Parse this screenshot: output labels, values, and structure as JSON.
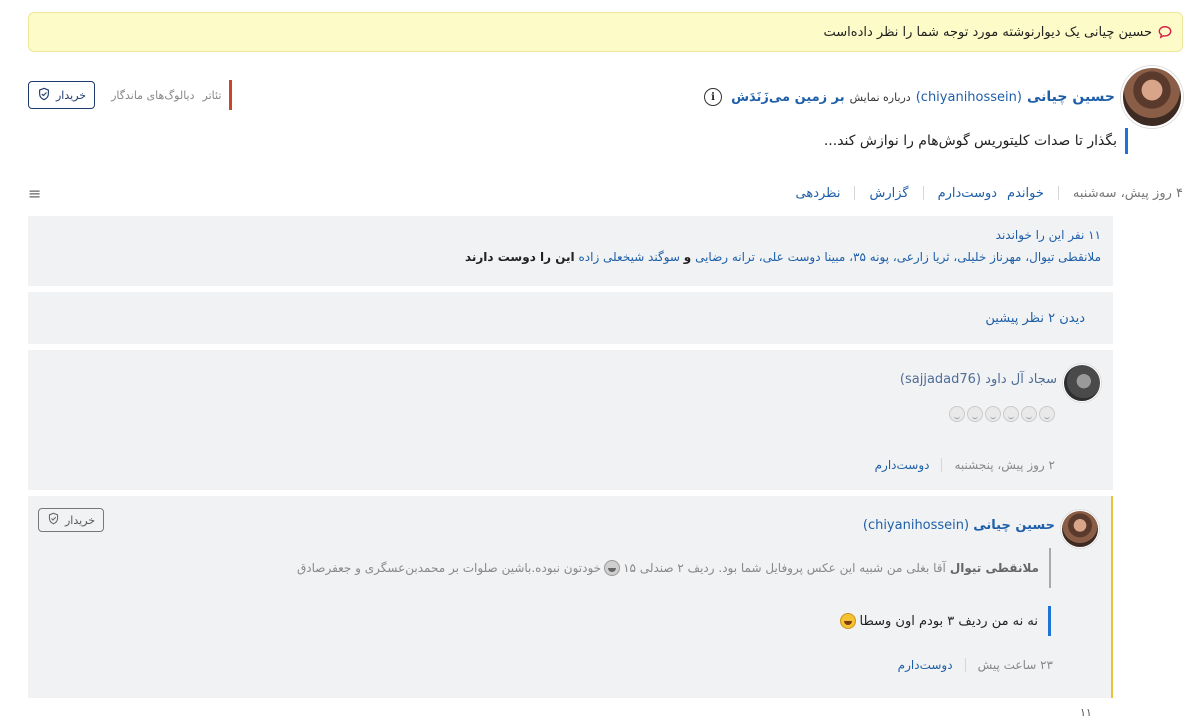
{
  "notice": {
    "text": "حسین چیانی یک دیوارنوشته مورد توجه شما را نظر داده‌است"
  },
  "post": {
    "author_name": "حسین چیانی",
    "author_user": "(chiyanihossein)",
    "about_text": "درباره نمایش",
    "show_title": "بر زمین می‌زَنَدَش",
    "info_icon": "i",
    "quote": "بگذار تا صدات کلیتوریس گوش‌هام را نوازش کند...",
    "categories": [
      "تئاتر",
      "دیالوگ‌های ماندگار"
    ],
    "buyer_label": "خریدار",
    "time": "۴ روز پیش، سه‌شنبه",
    "actions": [
      "خواندم",
      "دوست‌دارم",
      "گزارش",
      "نظردهی"
    ],
    "menu_icon": "≡",
    "readers_count": "۱۱ نفر این را خواندند",
    "likes_names": "ملانقطی تیوال، مهرناز خلیلی، ثریا زارعی، پونه ۳۵، مبینا دوست علی، ترانه رضایی",
    "likes_and": "و",
    "likes_last": "سوگند شیخعلی زاده",
    "likes_suffix": "این را دوست دارند",
    "view_previous": "دیدن ۲ نظر پیشین"
  },
  "comments": [
    {
      "author_name": "سجاد آل داود",
      "author_user": "(sajjadad76)",
      "time": "۲ روز پیش، پنجشنبه",
      "like_label": "دوست‌دارم"
    },
    {
      "author_name": "حسین چیانی",
      "author_user": "(chiyanihossein)",
      "buyer_label": "خریدار",
      "quoted_author": "ملانقطی تیوال",
      "quoted_text_a": "آقا بغلی من شبیه این عکس پروفایل شما بود. ردیف ۲ صندلی ۱۵",
      "quoted_text_b": "خودتون نبوده.باشین صلوات بر محمدبن‌عسگری و جعفرصادق",
      "reply": "نه نه من ردیف ۳ بودم اون وسطا",
      "time": "۲۳ ساعت پیش",
      "like_label": "دوست‌دارم"
    }
  ],
  "footer": {
    "number": "۱۱"
  },
  "colors": {
    "link": "#1e5fa8",
    "notice_bg": "#fdfbc8",
    "quote_bar": "#1e73d6",
    "highlight_border": "#e8c33b",
    "category_bar": "#c9462a"
  }
}
